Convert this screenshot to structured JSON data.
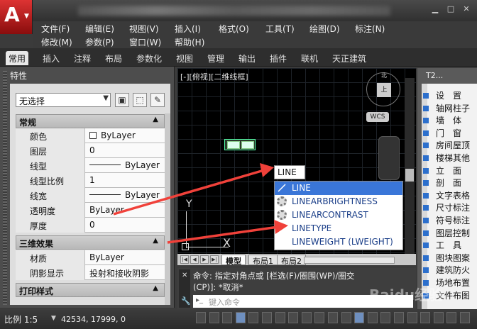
{
  "app": {
    "logo_letter": "A"
  },
  "menu": {
    "row1": [
      "文件(F)",
      "编辑(E)",
      "视图(V)",
      "插入(I)",
      "格式(O)",
      "工具(T)",
      "绘图(D)",
      "标注(N)"
    ],
    "row2": [
      "修改(M)",
      "参数(P)",
      "窗口(W)",
      "帮助(H)"
    ]
  },
  "ribbon_tabs": [
    "常用",
    "插入",
    "注释",
    "布局",
    "参数化",
    "视图",
    "管理",
    "输出",
    "插件",
    "联机",
    "天正建筑"
  ],
  "palette": {
    "title": "特性",
    "selection": "无选择",
    "sections": {
      "general": "常规",
      "3d": "三维效果",
      "print": "打印样式"
    },
    "general": [
      {
        "label": "颜色",
        "value": "ByLayer",
        "swatch": true
      },
      {
        "label": "图层",
        "value": "0"
      },
      {
        "label": "线型",
        "value": "ByLayer",
        "line": true
      },
      {
        "label": "线型比例",
        "value": "1"
      },
      {
        "label": "线宽",
        "value": "ByLayer",
        "line": true
      },
      {
        "label": "透明度",
        "value": "ByLayer"
      },
      {
        "label": "厚度",
        "value": "0"
      }
    ],
    "threed": [
      {
        "label": "材质",
        "value": "ByLayer"
      },
      {
        "label": "阴影显示",
        "value": "投射和接收阴影"
      }
    ]
  },
  "viewport": {
    "label": "[-][俯视][二维线框]",
    "compass_north": "北",
    "cube_face": "上",
    "wcs": "WCS",
    "ucs_y": "Y",
    "ucs_x": "X"
  },
  "autocomplete": {
    "typed": "LINE",
    "items": [
      "LINE",
      "LINEARBRIGHTNESS",
      "LINEARCONTRAST",
      "LINETYPE",
      "LINEWEIGHT (LWEIGHT)"
    ]
  },
  "layout_tabs": [
    "模型",
    "布局1",
    "布局2"
  ],
  "command": {
    "line1": "命令: 指定对角点或 [栏选(F)/圈围(WP)/圈交",
    "line2": "(CP)]: *取消*",
    "placeholder": "键入命令"
  },
  "tool_palette": {
    "title": "T2...",
    "items": [
      "设　置",
      "轴网柱子",
      "墙　体",
      "门　窗",
      "房间屋顶",
      "楼梯其他",
      "立　面",
      "剖　面",
      "文字表格",
      "尺寸标注",
      "符号标注",
      "图层控制",
      "工　具",
      "图块图案",
      "建筑防火",
      "场地布置",
      "文件布图"
    ]
  },
  "status": {
    "scale": "比例 1:5",
    "coords": "42534, 17999, 0"
  },
  "watermark": "Baidu经验",
  "colors": {
    "accent": "#3a76d8",
    "arrow": "#f0413a"
  }
}
